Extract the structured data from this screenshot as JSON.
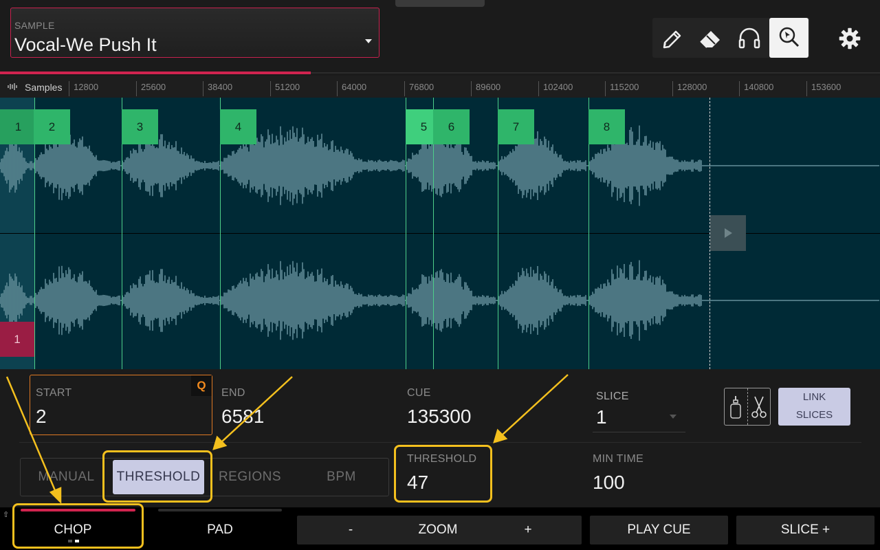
{
  "sample": {
    "label": "SAMPLE",
    "value": "Vocal-We Push It"
  },
  "toolbar": {
    "pencil": "pencil-icon",
    "eraser": "eraser-icon",
    "headphones": "headphones-icon",
    "zoom": "zoom-cursor-icon",
    "settings": "gear-icon"
  },
  "ruler": {
    "unit": "Samples",
    "ticks": [
      "12800",
      "25600",
      "38400",
      "51200",
      "64000",
      "76800",
      "89600",
      "102400",
      "115200",
      "128000",
      "140800",
      "153600"
    ]
  },
  "slices": {
    "tags": [
      "1",
      "2",
      "3",
      "4",
      "5",
      "6",
      "7",
      "8"
    ],
    "pad_tag": "1"
  },
  "params": {
    "start_label": "START",
    "start_value": "2",
    "quantize": "Q",
    "end_label": "END",
    "end_value": "6581",
    "cue_label": "CUE",
    "cue_value": "135300",
    "slice_label": "SLICE",
    "slice_value": "1",
    "link_line1": "LINK",
    "link_line2": "SLICES",
    "threshold_label": "THRESHOLD",
    "threshold_value": "47",
    "mintime_label": "MIN TIME",
    "mintime_value": "100"
  },
  "modes": [
    "MANUAL",
    "THRESHOLD",
    "REGIONS",
    "BPM"
  ],
  "bottom": {
    "chop": "CHOP",
    "pad": "PAD",
    "zoom_minus": "-",
    "zoom": "ZOOM",
    "zoom_plus": "+",
    "play_cue": "PLAY CUE",
    "slice_plus": "SLICE +"
  },
  "colors": {
    "accent": "#d0244f",
    "slice": "#2fb56a",
    "waveform_bg": "#002a36",
    "highlight": "#f4c01e",
    "active_btn": "#c9cbe4"
  }
}
